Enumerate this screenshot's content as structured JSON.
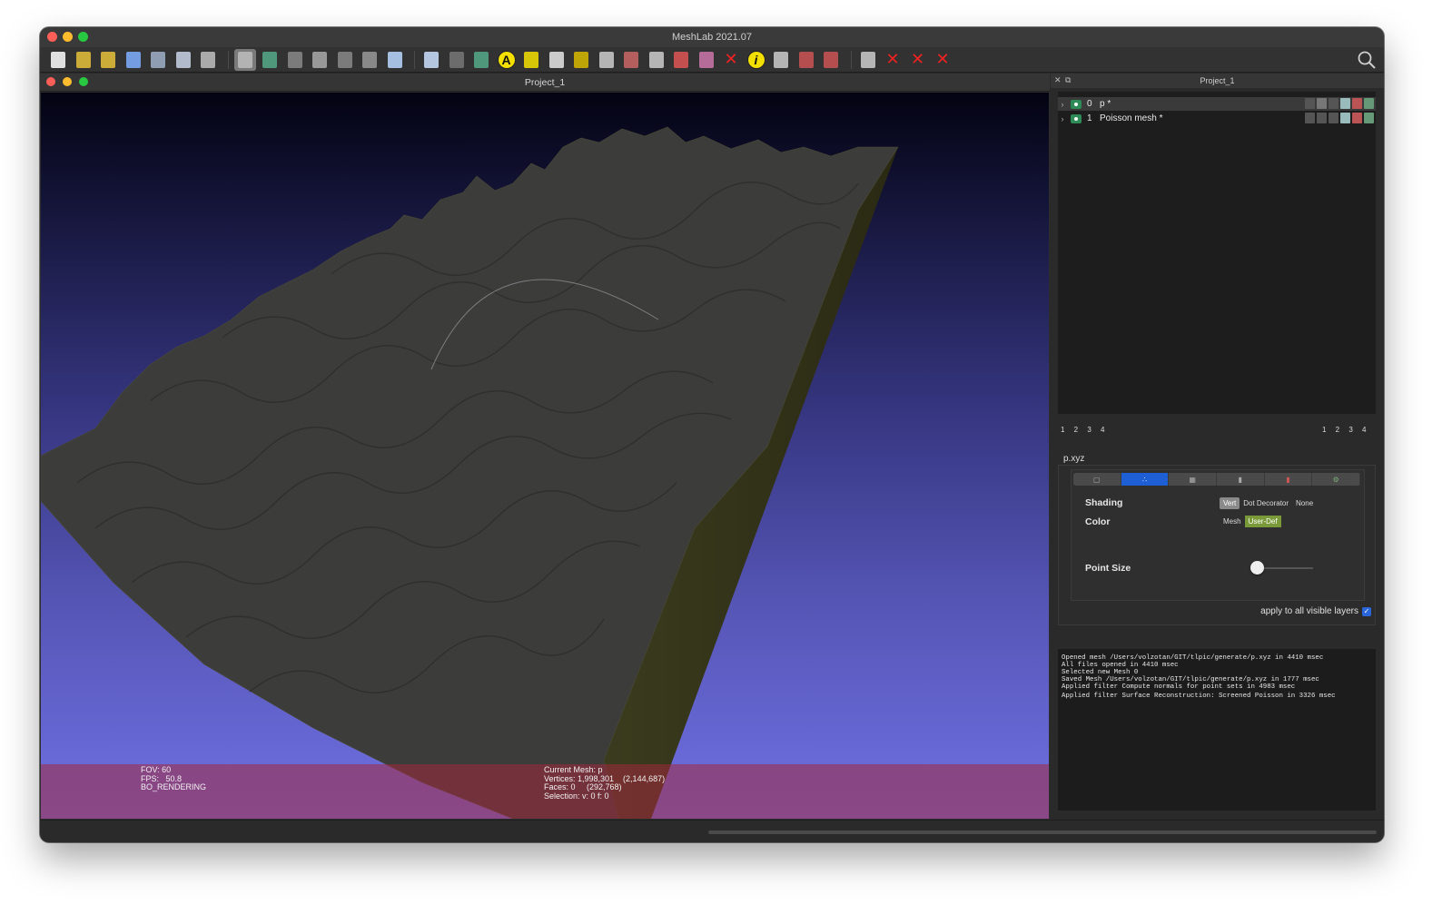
{
  "window": {
    "title": "MeshLab 2021.07"
  },
  "traffic_lights": {
    "close": "#ff5f57",
    "minimize": "#febc2e",
    "zoom": "#28c840"
  },
  "toolbar": {
    "icons": [
      "new-document-icon",
      "open-folder-icon",
      "open-project-icon",
      "reload-icon",
      "reload-all-icon",
      "import-raster-icon",
      "snapshot-icon",
      "layers-icon",
      "raster-layers-icon",
      "bounding-box-icon",
      "points-render-icon",
      "wireframe-render-icon",
      "flat-render-icon",
      "smooth-render-icon",
      "lighting-icon",
      "axes-icon",
      "trackball-icon",
      "annotation-icon",
      "ruler-icon",
      "paint-icon",
      "camera-icon",
      "brush-icon",
      "pickpoints-icon",
      "select-icon",
      "align-icon",
      "texture-icon",
      "delete-icon",
      "info-icon",
      "select-rect-icon",
      "select-connected-icon",
      "select-faces-icon",
      "select-vertices-icon",
      "delete-faces-icon",
      "delete-vertices-icon",
      "delete-selected-icon"
    ],
    "annotation_glyph": "A",
    "info_glyph": "i"
  },
  "viewport": {
    "title": "Project_1",
    "info_left": "FOV: 60\nFPS:   50.8\nBO_RENDERING",
    "info_center": "Current Mesh: p\nVertices: 1,998,301    (2,144,687)\nFaces: 0     (292,768)\nSelection: v: 0 f: 0"
  },
  "layer_panel": {
    "title": "Project_1",
    "layers": [
      {
        "index": "0",
        "name": "p *"
      },
      {
        "index": "1",
        "name": "Poisson mesh *"
      }
    ],
    "pager_left": "1 2 3 4",
    "pager_right": "1 2 3 4"
  },
  "render_props": {
    "mesh_name": "p.xyz",
    "shading_label": "Shading",
    "shading_options": [
      "Vert",
      "Dot Decorator",
      "None"
    ],
    "color_label": "Color",
    "color_options": [
      "Mesh",
      "User-Def"
    ],
    "point_size_label": "Point Size",
    "point_size_level": 0.1,
    "apply_label": "apply to all visible layers",
    "apply_checked": true
  },
  "log": [
    "Opened mesh /Users/volzotan/GIT/tlpic/generate/p.xyz in 4410 msec",
    "All files opened in 4410 msec",
    "Selected new Mesh 0",
    "Saved Mesh /Users/volzotan/GIT/tlpic/generate/p.xyz in 1777 msec",
    "Applied filter Compute normals for point sets in 4983 msec",
    "Applied filter Surface Reconstruction: Screened Poisson in 3326 msec"
  ]
}
